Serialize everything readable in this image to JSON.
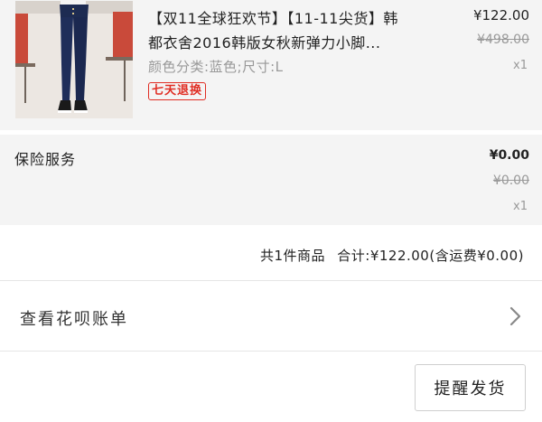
{
  "item": {
    "title_line1": "【双11全球狂欢节】【11-11尖货】韩",
    "title_line2": "都衣舍2016韩版女秋新弹力小脚...",
    "sku": "颜色分类:蓝色;尺寸:L",
    "badge": "七天退换",
    "price": "¥122.00",
    "original_price": "¥498.00",
    "quantity": "x1"
  },
  "service": {
    "label": "保险服务",
    "price": "¥0.00",
    "original_price": "¥0.00",
    "quantity": "x1"
  },
  "summary": {
    "count_text": "共1件商品",
    "total_text": "合计:¥122.00(含运费¥0.00)"
  },
  "huabei": {
    "label": "查看花呗账单"
  },
  "actions": {
    "remind_label": "提醒发货"
  },
  "colors": {
    "badge_red": "#e02e24",
    "section_bg": "#f4f4f4"
  }
}
